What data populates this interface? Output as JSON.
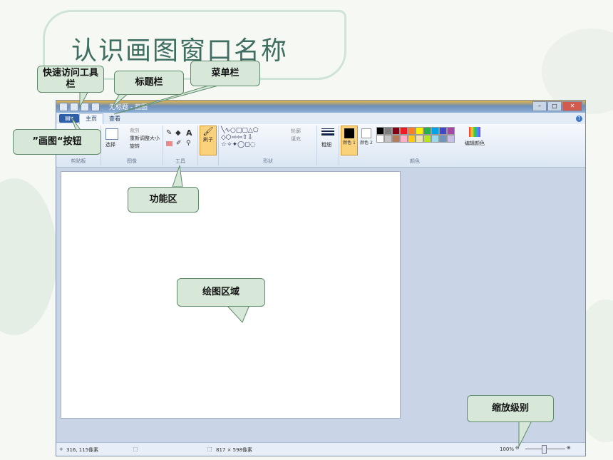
{
  "slide": {
    "title": "认识画图窗口名称"
  },
  "callouts": {
    "quick_access": "快速访问工具栏",
    "titlebar": "标题栏",
    "menubar": "菜单栏",
    "paint_button": "”画图“按钮",
    "ribbon": "功能区",
    "canvas": "绘图区域",
    "zoom": "缩放级别"
  },
  "window": {
    "title": "无标题 - 画图",
    "paint_button_label": "▤▾",
    "tabs": [
      "主页",
      "查看"
    ],
    "ribbon": {
      "groups": [
        {
          "label": "剪贴板"
        },
        {
          "label": "图像"
        },
        {
          "label": "工具"
        },
        {
          "label": ""
        },
        {
          "label": "形状"
        },
        {
          "label": ""
        },
        {
          "label": "颜色"
        }
      ],
      "image": {
        "select": "选择",
        "crop": "裁剪",
        "resize": "重新调整大小",
        "rotate": "旋转"
      },
      "brush": "刷子",
      "outline": "轮廓",
      "fill": "填充",
      "size": "粗细",
      "color1": "颜色 1",
      "color2": "颜色 2",
      "edit_colors": "编辑颜色",
      "palette": [
        "#000000",
        "#7f7f7f",
        "#880015",
        "#ed1c24",
        "#ff7f27",
        "#fff200",
        "#22b14c",
        "#00a2e8",
        "#3f48cc",
        "#a349a4",
        "#ffffff",
        "#c3c3c3",
        "#b97a57",
        "#ffaec9",
        "#ffc90e",
        "#efe4b0",
        "#b5e61d",
        "#99d9ea",
        "#7092be",
        "#c8bfe7"
      ]
    },
    "status": {
      "cursor": "316, 115像素",
      "size": "817 × 598像素",
      "zoom": "100%"
    }
  }
}
